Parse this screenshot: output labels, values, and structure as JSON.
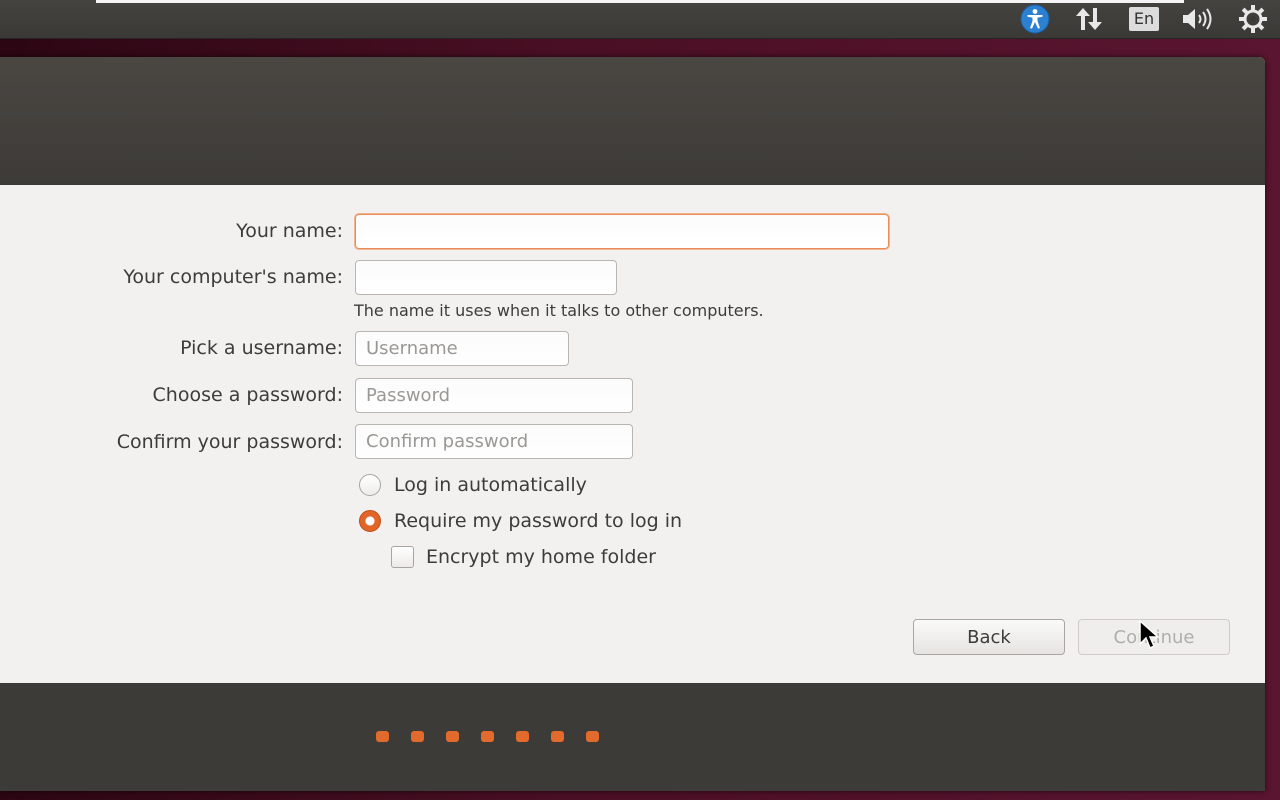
{
  "panel": {
    "language": "En",
    "icons": [
      "accessibility-icon",
      "network-icon",
      "language-icon",
      "volume-icon",
      "settings-gear-icon"
    ]
  },
  "form": {
    "your_name": {
      "label": "Your name:",
      "value": ""
    },
    "computer_name": {
      "label": "Your computer's name:",
      "value": "",
      "hint": "The name it uses when it talks to other computers."
    },
    "username": {
      "label": "Pick a username:",
      "placeholder": "Username"
    },
    "password": {
      "label": "Choose a password:",
      "placeholder": "Password"
    },
    "confirm": {
      "label": "Confirm your password:",
      "placeholder": "Confirm password"
    },
    "login_auto": {
      "label": "Log in automatically",
      "checked": false
    },
    "login_require": {
      "label": "Require my password to log in",
      "checked": true
    },
    "encrypt": {
      "label": "Encrypt my home folder",
      "checked": false
    }
  },
  "buttons": {
    "back": "Back",
    "continue": "Continue"
  },
  "progress": {
    "total_steps": 7
  },
  "colors": {
    "accent": "#e16526",
    "header": "#3d3b37",
    "window_bg": "#f2f1f0",
    "panel_bg": "#3a3935"
  }
}
